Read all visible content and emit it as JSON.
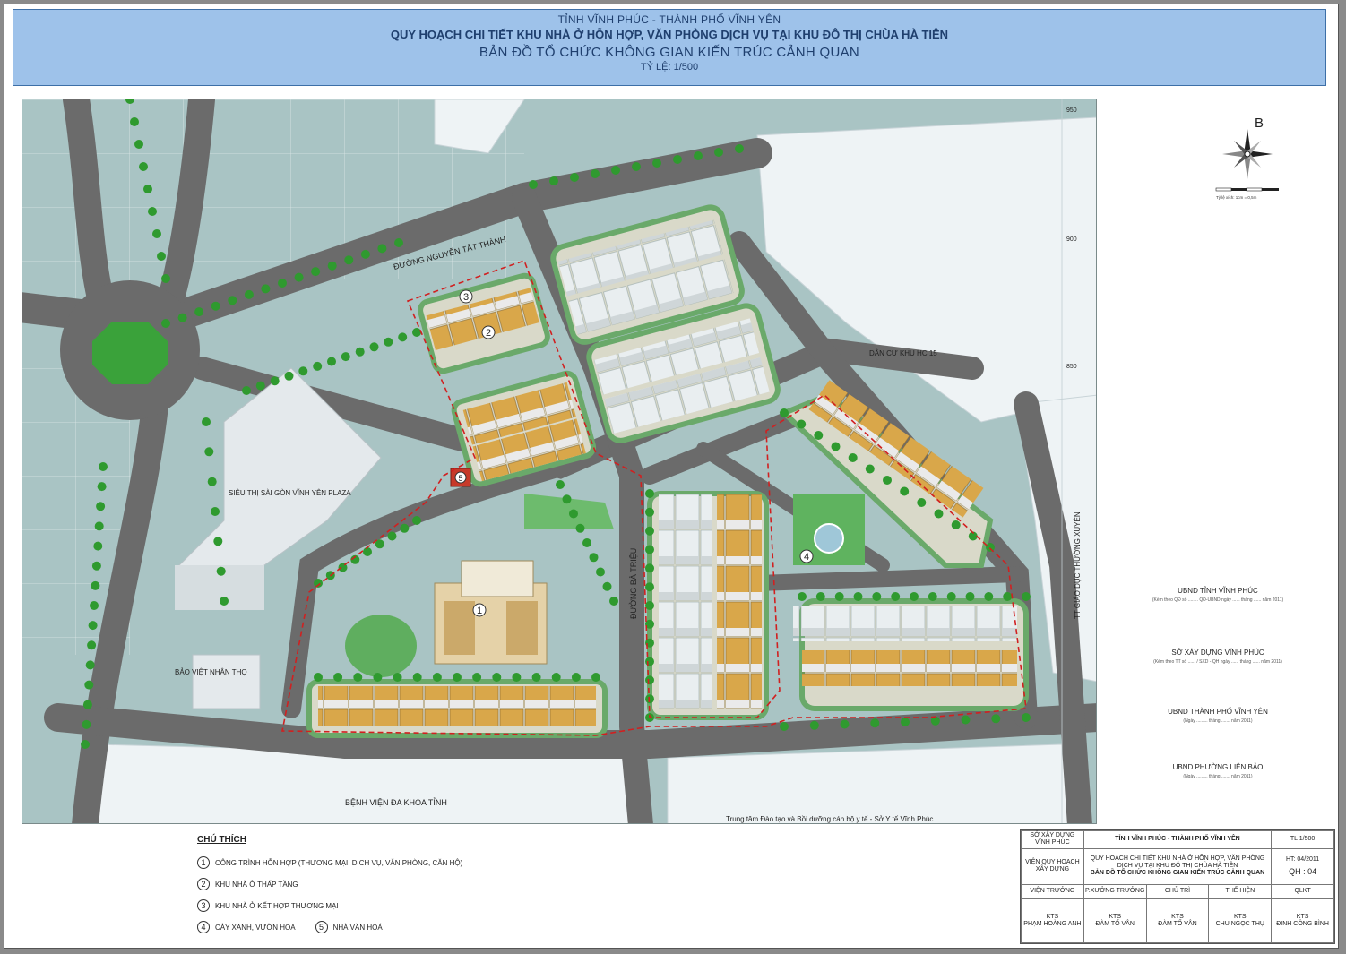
{
  "header": {
    "line1": "TỈNH VĨNH PHÚC - THÀNH PHỐ VĨNH YÊN",
    "line2": "QUY HOẠCH CHI TIẾT KHU NHÀ Ở HỖN HỢP, VĂN PHÒNG DỊCH VỤ TẠI KHU ĐÔ THỊ CHÙA HÀ TIÊN",
    "line3": "BẢN ĐỒ TỔ CHỨC KHÔNG GIAN KIẾN TRÚC CẢNH QUAN",
    "line4": "TỶ LỆ: 1/500"
  },
  "map": {
    "labels": {
      "road_nguyen_tat_thanh": "ĐƯỜNG NGUYỄN TẤT THÀNH",
      "road_ba_trieu": "ĐƯỜNG BÀ TRIỆU",
      "supermarket": "SIÊU THỊ SÀI GÒN VĨNH YÊN PLAZA",
      "bao_viet": "BẢO VIỆT NHÂN THỌ",
      "hospital": "BỆNH VIỆN ĐA KHOA TỈNH",
      "residential": "DÂN CƯ KHU HC 15",
      "education": "TT GIÁO DỤC THƯỜNG XUYÊN",
      "training_center": "Trung tâm Đào tạo và Bồi dưỡng cán bộ y tế - Sở Y tế Vĩnh Phúc"
    },
    "zone_numbers": [
      "1",
      "2",
      "3",
      "4",
      "5"
    ],
    "grid_ticks": [
      "950",
      "900",
      "850"
    ],
    "colors": {
      "road": "#6b6b6b",
      "ground": "#a9c4c4",
      "roof": "#d9a74a",
      "tree": "#2f9a2f",
      "boundary": "#d12020"
    }
  },
  "compass": {
    "label": "B",
    "scale_note": "Tỷ lệ xích: 1cm = 0,5m"
  },
  "approvals": [
    {
      "title": "UBND TỈNH VĨNH PHÚC",
      "sub": "(Kèm theo QĐ số ........ QĐ-UBND ngày ...... tháng ...... năm 2011)"
    },
    {
      "title": "SỞ XÂY DỰNG VĨNH PHÚC",
      "sub": "(Kèm theo TT số ...... / SXD - QH ngày ...... tháng ...... năm 2011)"
    },
    {
      "title": "UBND THÀNH PHỐ VĨNH YÊN",
      "sub": "(Ngày ......... tháng ....... năm 2011)"
    },
    {
      "title": "UBND PHƯỜNG LIÊN BẢO",
      "sub": "(Ngày ......... tháng ....... năm 2011)"
    }
  ],
  "legend": {
    "title": "CHÚ THÍCH",
    "items": [
      {
        "num": "1",
        "text": "CÔNG TRÌNH HỖN HỢP (THƯƠNG MẠI, DỊCH VỤ, VĂN PHÒNG, CĂN HỘ)"
      },
      {
        "num": "2",
        "text": "KHU NHÀ Ở THẤP TẦNG"
      },
      {
        "num": "3",
        "text": "KHU NHÀ Ở KẾT HỢP THƯƠNG MẠI"
      },
      {
        "num": "4",
        "text": "CÂY XANH, VƯỜN HOA"
      },
      {
        "num": "5",
        "text": "NHÀ VĂN HOÁ"
      }
    ]
  },
  "titleblock": {
    "org": "SỞ XÂY DỰNG VĨNH PHÚC",
    "province": "TỈNH VĨNH PHÚC - THÀNH PHỐ VĨNH YÊN",
    "scale": "TL 1/500",
    "institute": "VIỆN QUY HOẠCH XÂY DỰNG",
    "project": "QUY HOẠCH CHI TIẾT KHU NHÀ Ở HỖN HỢP, VĂN PHÒNG DỊCH VỤ TẠI KHU ĐÔ THỊ CHÙA HÀ TIÊN",
    "drawing": "BẢN ĐỒ TỔ CHỨC KHÔNG GIAN KIẾN TRÚC CẢNH QUAN",
    "ht": "HT: 04/2011",
    "code": "QH : 04",
    "roles": [
      "VIỆN TRƯỞNG",
      "P.XƯỞNG TRƯỞNG",
      "CHỦ TRÌ",
      "THỂ HIỆN",
      "QLKT"
    ],
    "titles": [
      "KTS",
      "KTS",
      "KTS",
      "KTS",
      "KTS"
    ],
    "names": [
      "PHẠM HOÀNG ANH",
      "ĐÀM TỐ VÂN",
      "ĐÀM TỐ VÂN",
      "CHU NGỌC THỤ",
      "ĐINH CÔNG BÌNH"
    ]
  }
}
